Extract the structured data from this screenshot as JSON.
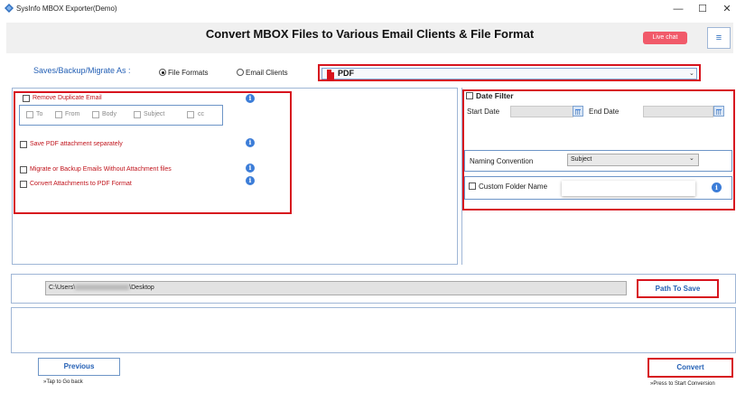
{
  "window": {
    "title": "SysInfo MBOX Exporter(Demo)",
    "minimize": "—",
    "maximize": "☐",
    "close": "✕"
  },
  "header": {
    "title": "Convert MBOX Files to Various Email Clients & File Format",
    "live_chat": "Live chat",
    "menu_icon": "≡"
  },
  "save_as": {
    "label": "Saves/Backup/Migrate As :",
    "options": [
      "File Formats",
      "Email Clients"
    ],
    "selected_option": "File Formats",
    "format_selected": "PDF"
  },
  "left_options": {
    "remove_duplicate": "Remove Duplicate Email",
    "fields": [
      "To",
      "From",
      "Body",
      "Subject",
      "cc"
    ],
    "save_pdf_attachment": "Save PDF attachment separately",
    "migrate_without_attachment": "Migrate or Backup Emails Without Attachment files",
    "convert_attachments_pdf": "Convert Attachments to PDF Format"
  },
  "right_options": {
    "date_filter": "Date Filter",
    "start_date": "Start Date",
    "end_date": "End Date",
    "naming_convention": "Naming Convention",
    "naming_selected": "Subject",
    "custom_folder_name": "Custom Folder Name"
  },
  "path": {
    "value_prefix": "C:\\Users\\",
    "value_suffix": "\\Desktop",
    "button": "Path To Save"
  },
  "footer": {
    "previous": "Previous",
    "previous_hint": "»Tap to Go back",
    "convert": "Convert",
    "convert_hint": "»Press to Start Conversion"
  },
  "colors": {
    "accent": "#2460b5",
    "highlight_red": "#d7141e",
    "live_chat": "#f15a6a"
  }
}
